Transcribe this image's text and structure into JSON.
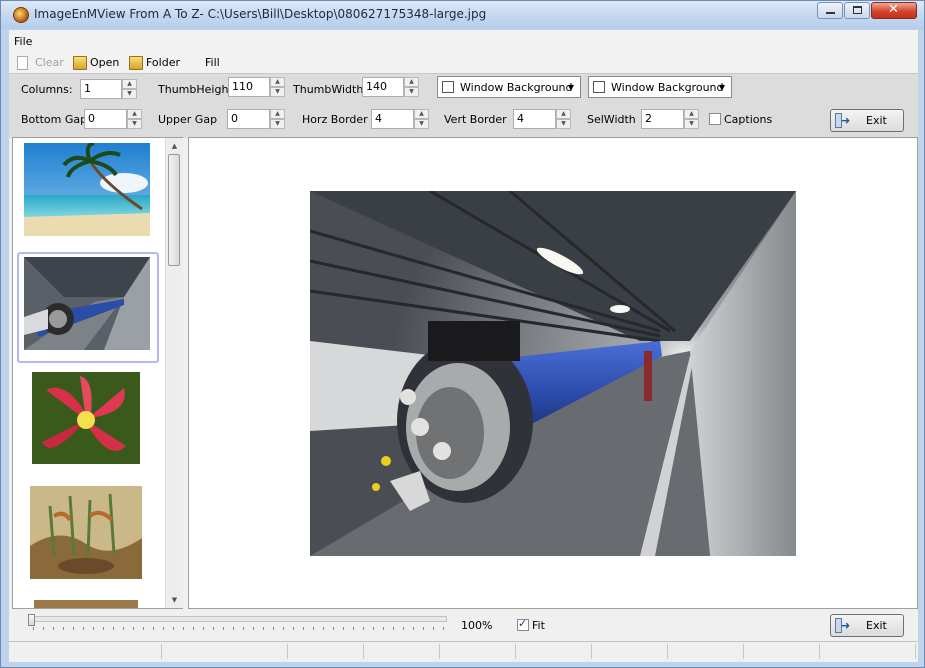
{
  "window": {
    "title": "ImageEnMView From A To Z- C:\\Users\\Bill\\Desktop\\080627175348-large.jpg",
    "icon": "app-globe-icon"
  },
  "menu": {
    "file": "File"
  },
  "toolbar": {
    "clear": "Clear",
    "open": "Open",
    "folder": "Folder",
    "fill": "Fill"
  },
  "options": {
    "columns_label": "Columns:",
    "columns_value": "1",
    "thumbheight_label": "ThumbHeight",
    "thumbheight_value": "110",
    "thumbwidth_label": "ThumbWidth",
    "thumbwidth_value": "140",
    "window_bg1": "Window Background",
    "window_bg2": "Window Background",
    "bottomgap_label": "Bottom Gap",
    "bottomgap_value": "0",
    "uppergap_label": "Upper Gap",
    "uppergap_value": "0",
    "horzborder_label": "Horz Border",
    "horzborder_value": "4",
    "vertborder_label": "Vert Border",
    "vertborder_value": "4",
    "selwidth_label": "SelWidth",
    "selwidth_value": "2",
    "captions_label": "Captions",
    "exit": "Exit"
  },
  "bottom": {
    "zoom": "100%",
    "fit": "Fit",
    "exit": "Exit"
  },
  "thumbnails": [
    "beach-palm-thumbnail",
    "particle-accelerator-tunnel-thumbnail",
    "red-lily-flower-thumbnail",
    "ancient-mural-thumbnail",
    "partial-thumbnail"
  ]
}
